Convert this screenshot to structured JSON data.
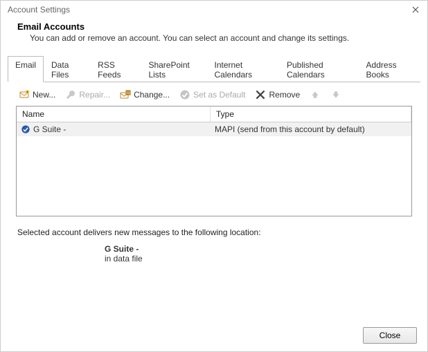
{
  "titlebar": {
    "title": "Account Settings"
  },
  "header": {
    "title": "Email Accounts",
    "description": "You can add or remove an account. You can select an account and change its settings."
  },
  "tabs": {
    "email": "Email",
    "data_files": "Data Files",
    "rss": "RSS Feeds",
    "sharepoint": "SharePoint Lists",
    "internet_cal": "Internet Calendars",
    "published_cal": "Published Calendars",
    "address_books": "Address Books"
  },
  "toolbar": {
    "new": "New...",
    "repair": "Repair...",
    "change": "Change...",
    "set_default": "Set as Default",
    "remove": "Remove"
  },
  "columns": {
    "name": "Name",
    "type": "Type"
  },
  "accounts": [
    {
      "name": "G Suite -",
      "type": "MAPI (send from this account by default)"
    }
  ],
  "footer": {
    "line1": "Selected account delivers new messages to the following location:",
    "line2a": "G Suite -",
    "line2b": "in data file"
  },
  "buttons": {
    "close": "Close"
  }
}
